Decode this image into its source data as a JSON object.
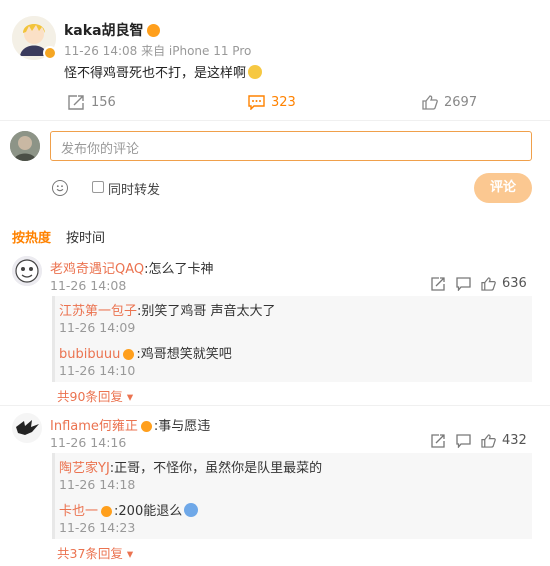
{
  "post": {
    "author": "kaka胡良智",
    "meta": "11-26 14:08 来自 iPhone 11 Pro",
    "text": "怪不得鸡哥死也不打，是这样啊",
    "reposts": "156",
    "comments": "323",
    "likes": "2697"
  },
  "composer": {
    "placeholder": "发布你的评论",
    "repost_label": "同时转发",
    "submit_label": "评论"
  },
  "sort": {
    "hot": "按热度",
    "time": "按时间"
  },
  "comments": [
    {
      "user": "老鸡奇遇记QAQ",
      "text": ":怎么了卡神",
      "time": "11-26 14:08",
      "likes": "636",
      "replies": [
        {
          "user": "江苏第一包子",
          "text": ":别笑了鸡哥 声音太大了",
          "time": "11-26 14:09"
        },
        {
          "user": "bubibuuu",
          "text": ":鸡哥想笑就笑吧",
          "time": "11-26 14:10"
        }
      ],
      "more": "共90条回复"
    },
    {
      "user": "Inflame何雍正",
      "text": ":事与愿违",
      "time": "11-26 14:16",
      "likes": "432",
      "replies": [
        {
          "user": "陶艺家YJ",
          "text": ":正哥，不怪你，虽然你是队里最菜的",
          "time": "11-26 14:18"
        },
        {
          "user": "卡也一",
          "text": ":200能退么",
          "time": "11-26 14:23"
        }
      ],
      "more": "共37条回复"
    }
  ],
  "colors": {
    "accent": "#ff8200",
    "username": "#eb7350",
    "input_border": "#f0a04b",
    "submit_bg": "#fbc891"
  }
}
